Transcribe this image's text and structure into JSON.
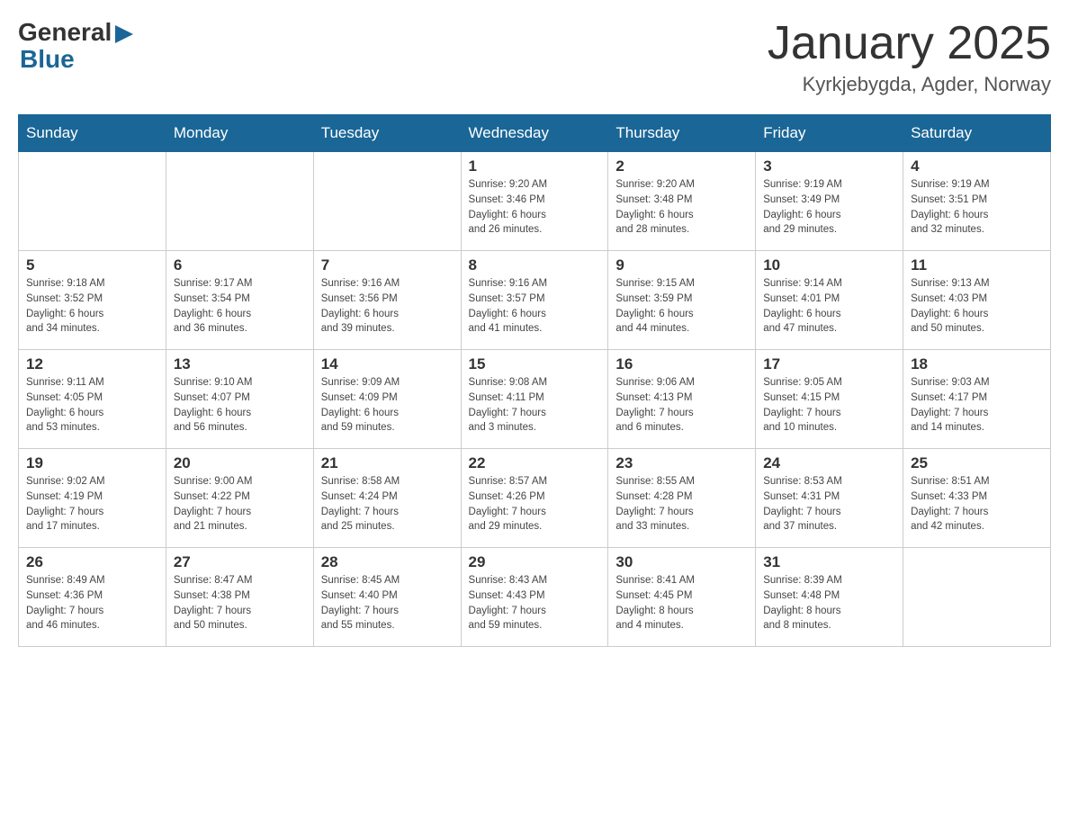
{
  "header": {
    "title": "January 2025",
    "subtitle": "Kyrkjebygda, Agder, Norway",
    "logo_general": "General",
    "logo_blue": "Blue"
  },
  "days_of_week": [
    "Sunday",
    "Monday",
    "Tuesday",
    "Wednesday",
    "Thursday",
    "Friday",
    "Saturday"
  ],
  "weeks": [
    [
      {
        "day": "",
        "info": ""
      },
      {
        "day": "",
        "info": ""
      },
      {
        "day": "",
        "info": ""
      },
      {
        "day": "1",
        "info": "Sunrise: 9:20 AM\nSunset: 3:46 PM\nDaylight: 6 hours\nand 26 minutes."
      },
      {
        "day": "2",
        "info": "Sunrise: 9:20 AM\nSunset: 3:48 PM\nDaylight: 6 hours\nand 28 minutes."
      },
      {
        "day": "3",
        "info": "Sunrise: 9:19 AM\nSunset: 3:49 PM\nDaylight: 6 hours\nand 29 minutes."
      },
      {
        "day": "4",
        "info": "Sunrise: 9:19 AM\nSunset: 3:51 PM\nDaylight: 6 hours\nand 32 minutes."
      }
    ],
    [
      {
        "day": "5",
        "info": "Sunrise: 9:18 AM\nSunset: 3:52 PM\nDaylight: 6 hours\nand 34 minutes."
      },
      {
        "day": "6",
        "info": "Sunrise: 9:17 AM\nSunset: 3:54 PM\nDaylight: 6 hours\nand 36 minutes."
      },
      {
        "day": "7",
        "info": "Sunrise: 9:16 AM\nSunset: 3:56 PM\nDaylight: 6 hours\nand 39 minutes."
      },
      {
        "day": "8",
        "info": "Sunrise: 9:16 AM\nSunset: 3:57 PM\nDaylight: 6 hours\nand 41 minutes."
      },
      {
        "day": "9",
        "info": "Sunrise: 9:15 AM\nSunset: 3:59 PM\nDaylight: 6 hours\nand 44 minutes."
      },
      {
        "day": "10",
        "info": "Sunrise: 9:14 AM\nSunset: 4:01 PM\nDaylight: 6 hours\nand 47 minutes."
      },
      {
        "day": "11",
        "info": "Sunrise: 9:13 AM\nSunset: 4:03 PM\nDaylight: 6 hours\nand 50 minutes."
      }
    ],
    [
      {
        "day": "12",
        "info": "Sunrise: 9:11 AM\nSunset: 4:05 PM\nDaylight: 6 hours\nand 53 minutes."
      },
      {
        "day": "13",
        "info": "Sunrise: 9:10 AM\nSunset: 4:07 PM\nDaylight: 6 hours\nand 56 minutes."
      },
      {
        "day": "14",
        "info": "Sunrise: 9:09 AM\nSunset: 4:09 PM\nDaylight: 6 hours\nand 59 minutes."
      },
      {
        "day": "15",
        "info": "Sunrise: 9:08 AM\nSunset: 4:11 PM\nDaylight: 7 hours\nand 3 minutes."
      },
      {
        "day": "16",
        "info": "Sunrise: 9:06 AM\nSunset: 4:13 PM\nDaylight: 7 hours\nand 6 minutes."
      },
      {
        "day": "17",
        "info": "Sunrise: 9:05 AM\nSunset: 4:15 PM\nDaylight: 7 hours\nand 10 minutes."
      },
      {
        "day": "18",
        "info": "Sunrise: 9:03 AM\nSunset: 4:17 PM\nDaylight: 7 hours\nand 14 minutes."
      }
    ],
    [
      {
        "day": "19",
        "info": "Sunrise: 9:02 AM\nSunset: 4:19 PM\nDaylight: 7 hours\nand 17 minutes."
      },
      {
        "day": "20",
        "info": "Sunrise: 9:00 AM\nSunset: 4:22 PM\nDaylight: 7 hours\nand 21 minutes."
      },
      {
        "day": "21",
        "info": "Sunrise: 8:58 AM\nSunset: 4:24 PM\nDaylight: 7 hours\nand 25 minutes."
      },
      {
        "day": "22",
        "info": "Sunrise: 8:57 AM\nSunset: 4:26 PM\nDaylight: 7 hours\nand 29 minutes."
      },
      {
        "day": "23",
        "info": "Sunrise: 8:55 AM\nSunset: 4:28 PM\nDaylight: 7 hours\nand 33 minutes."
      },
      {
        "day": "24",
        "info": "Sunrise: 8:53 AM\nSunset: 4:31 PM\nDaylight: 7 hours\nand 37 minutes."
      },
      {
        "day": "25",
        "info": "Sunrise: 8:51 AM\nSunset: 4:33 PM\nDaylight: 7 hours\nand 42 minutes."
      }
    ],
    [
      {
        "day": "26",
        "info": "Sunrise: 8:49 AM\nSunset: 4:36 PM\nDaylight: 7 hours\nand 46 minutes."
      },
      {
        "day": "27",
        "info": "Sunrise: 8:47 AM\nSunset: 4:38 PM\nDaylight: 7 hours\nand 50 minutes."
      },
      {
        "day": "28",
        "info": "Sunrise: 8:45 AM\nSunset: 4:40 PM\nDaylight: 7 hours\nand 55 minutes."
      },
      {
        "day": "29",
        "info": "Sunrise: 8:43 AM\nSunset: 4:43 PM\nDaylight: 7 hours\nand 59 minutes."
      },
      {
        "day": "30",
        "info": "Sunrise: 8:41 AM\nSunset: 4:45 PM\nDaylight: 8 hours\nand 4 minutes."
      },
      {
        "day": "31",
        "info": "Sunrise: 8:39 AM\nSunset: 4:48 PM\nDaylight: 8 hours\nand 8 minutes."
      },
      {
        "day": "",
        "info": ""
      }
    ]
  ]
}
